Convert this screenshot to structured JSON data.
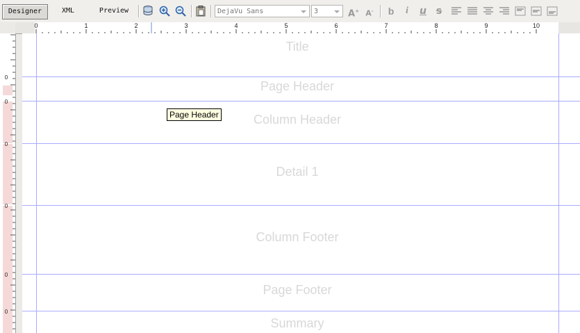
{
  "toolbar": {
    "tabs": [
      {
        "label": "Designer",
        "active": true
      },
      {
        "label": "XML",
        "active": false
      },
      {
        "label": "Preview",
        "active": false
      }
    ],
    "font_family": "DejaVu Sans",
    "font_size": "3"
  },
  "ruler": {
    "h_labels": [
      "0",
      "1",
      "2",
      "3",
      "4",
      "5",
      "6",
      "7",
      "8",
      "9",
      "10"
    ],
    "v_labels": [
      "0",
      "0",
      "0",
      "0",
      "0",
      "0"
    ]
  },
  "bands": [
    "Title",
    "Page Header",
    "Column Header",
    "Detail 1",
    "Column Footer",
    "Page Footer",
    "Summary"
  ],
  "tooltip": "Page Header",
  "colors": {
    "band_line": "#aaaaff",
    "band_label": "#d8d8d8",
    "ruler_highlight": "#f5d9d9"
  }
}
